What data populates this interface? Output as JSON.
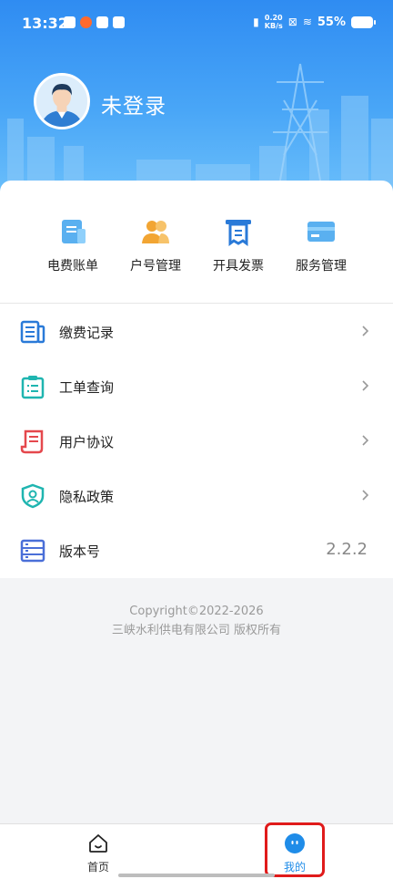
{
  "status_bar": {
    "time": "13:32",
    "net_speed_value": "0.20",
    "net_speed_unit": "KB/s",
    "battery": "55%"
  },
  "profile": {
    "login_status": "未登录"
  },
  "quick_actions": [
    {
      "label": "电费账单",
      "icon": "bill-icon",
      "color": "#5ab0f0"
    },
    {
      "label": "户号管理",
      "icon": "users-icon",
      "color": "#f2a533"
    },
    {
      "label": "开具发票",
      "icon": "invoice-icon",
      "color": "#2a7ad8"
    },
    {
      "label": "服务管理",
      "icon": "card-icon",
      "color": "#5ab0f0"
    }
  ],
  "menu": [
    {
      "label": "缴费记录",
      "icon": "payment-records-icon",
      "color": "#2a7ad8"
    },
    {
      "label": "工单查询",
      "icon": "clipboard-icon",
      "color": "#1fb5b0"
    },
    {
      "label": "用户协议",
      "icon": "scroll-icon",
      "color": "#e5484d"
    },
    {
      "label": "隐私政策",
      "icon": "shield-user-icon",
      "color": "#1fb5b0"
    },
    {
      "label": "版本号",
      "icon": "server-icon",
      "color": "#4a6fd8",
      "value": "2.2.2"
    }
  ],
  "footer": {
    "copyright": "Copyright©2022-2026",
    "company": "三峡水利供电有限公司 版权所有"
  },
  "tabbar": [
    {
      "label": "首页",
      "icon": "home-icon"
    },
    {
      "label": "我的",
      "icon": "profile-icon",
      "active": true
    }
  ],
  "colors": {
    "header_top": "#2f8cf2",
    "header_bottom": "#6cc0fb",
    "accent": "#1f8ce8",
    "highlight": "#e01b1b"
  }
}
